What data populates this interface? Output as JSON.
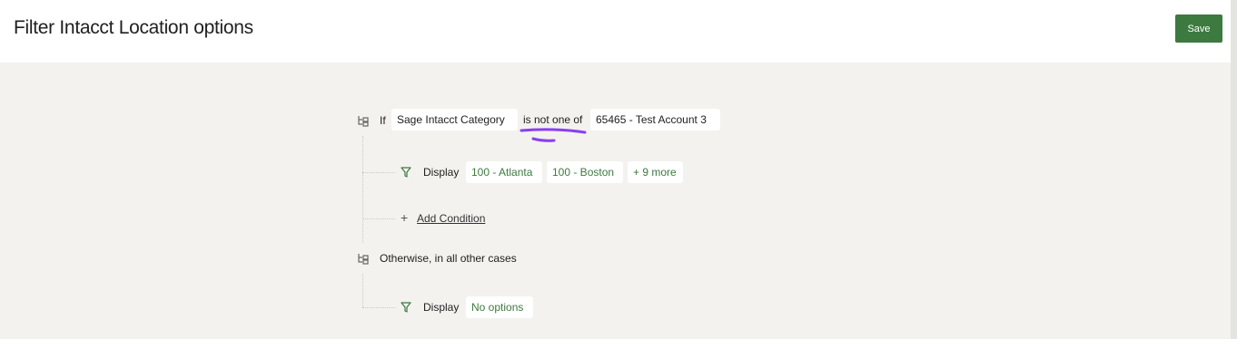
{
  "header": {
    "title": "Filter Intacct Location options",
    "save_label": "Save"
  },
  "rule": {
    "if_label": "If",
    "field": "Sage Intacct Category",
    "operator": "is not one of",
    "value": "65465 - Test Account 3",
    "display_label": "Display",
    "options": [
      "100 - Atlanta",
      "100 - Boston",
      "+ 9 more"
    ],
    "add_condition_label": "Add Condition"
  },
  "otherwise": {
    "label": "Otherwise, in all other cases",
    "display_label": "Display",
    "option": "No options"
  },
  "colors": {
    "accent": "#3c7a3f",
    "background": "#f3f2ee",
    "annotation": "#8a3ff0"
  },
  "icons": [
    "branch-icon",
    "filter-icon",
    "plus-icon"
  ]
}
